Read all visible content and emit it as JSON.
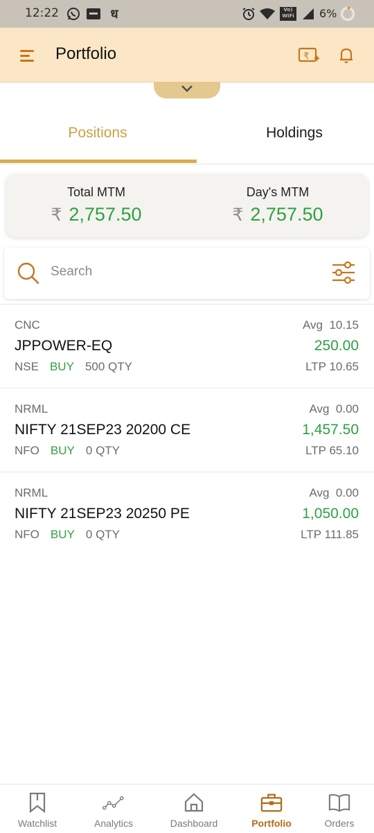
{
  "status_bar": {
    "time": "12:22",
    "battery_percent": "6%",
    "icons": [
      "whatsapp-icon",
      "zerodha-icon",
      "app-icon",
      "alarm-icon",
      "wifi-icon",
      "vowifi-icon",
      "signal-icon",
      "battery-icon"
    ],
    "vowifi_label": "Vo) WiFi"
  },
  "app_bar": {
    "title": "Portfolio",
    "menu_icon": "hamburger-menu-icon",
    "funds_icon": "rupee-add-funds-icon",
    "notifications_icon": "bell-icon"
  },
  "tabs": [
    {
      "label": "Positions",
      "active": true
    },
    {
      "label": "Holdings",
      "active": false
    }
  ],
  "mtm": {
    "currency_symbol": "₹",
    "total_label": "Total MTM",
    "total_value": "2,757.50",
    "day_label": "Day's MTM",
    "day_value": "2,757.50"
  },
  "search": {
    "placeholder": "Search"
  },
  "positions": [
    {
      "product": "CNC",
      "symbol": "JPPOWER-EQ",
      "exchange": "NSE",
      "side": "BUY",
      "qty": "500",
      "qty_label": "QTY",
      "avg_label": "Avg",
      "avg": "10.15",
      "pnl": "250.00",
      "ltp_label": "LTP",
      "ltp": "10.65"
    },
    {
      "product": "NRML",
      "symbol": "NIFTY 21SEP23 20200 CE",
      "exchange": "NFO",
      "side": "BUY",
      "qty": "0",
      "qty_label": "QTY",
      "avg_label": "Avg",
      "avg": "0.00",
      "pnl": "1,457.50",
      "ltp_label": "LTP",
      "ltp": "65.10"
    },
    {
      "product": "NRML",
      "symbol": "NIFTY 21SEP23 20250 PE",
      "exchange": "NFO",
      "side": "BUY",
      "qty": "0",
      "qty_label": "QTY",
      "avg_label": "Avg",
      "avg": "0.00",
      "pnl": "1,050.00",
      "ltp_label": "LTP",
      "ltp": "111.85"
    }
  ],
  "bottom_nav": [
    {
      "label": "Watchlist",
      "icon": "bookmark-icon",
      "active": false
    },
    {
      "label": "Analytics",
      "icon": "analytics-line-icon",
      "active": false
    },
    {
      "label": "Dashboard",
      "icon": "home-icon",
      "active": false
    },
    {
      "label": "Portfolio",
      "icon": "briefcase-icon",
      "active": true
    },
    {
      "label": "Orders",
      "icon": "book-icon",
      "active": false
    }
  ],
  "colors": {
    "accent_gold": "#d6ac4f",
    "app_bar_bg": "#fbe7c6",
    "profit_green": "#2ea043",
    "active_nav": "#b36b18"
  }
}
